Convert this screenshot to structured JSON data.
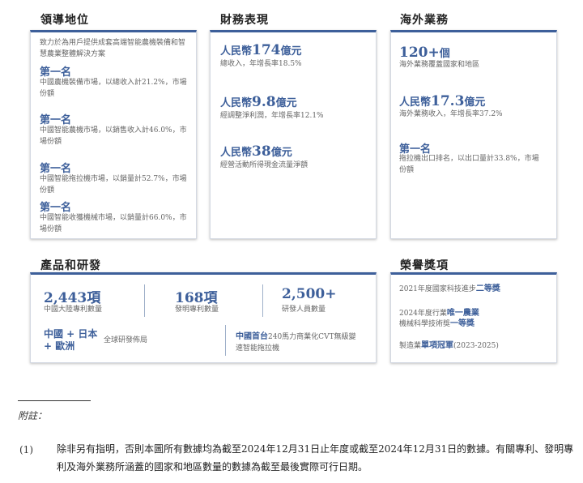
{
  "sections": {
    "leadership": "領導地位",
    "finance": "財務表現",
    "overseas": "海外業務",
    "products": "產品和研發",
    "honors": "榮譽獎項"
  },
  "leadership": {
    "intro": "致力於為用戶提供成套高端智能農機裝備和智慧農業整體解決方案",
    "items": [
      {
        "rank": "第一名",
        "desc": "中國農機裝備市場，以總收入計21.2%，市場份額"
      },
      {
        "rank": "第一名",
        "desc": "中國智能農機市場，以銷售收入計46.0%，市場份額"
      },
      {
        "rank": "第一名",
        "desc": "中國智能拖拉機市場，以銷量計52.7%，市場份額"
      },
      {
        "rank": "第一名",
        "desc": "中國智能收獲機械市場，以銷量計66.0%，市場份額"
      }
    ]
  },
  "finance": {
    "items": [
      {
        "prefix": "人民幣",
        "num": "174",
        "suffix": "億元",
        "desc": "總收入，年增長率18.5%"
      },
      {
        "prefix": "人民幣",
        "num": "9.8",
        "suffix": "億元",
        "desc": "經調整淨利潤，年增長率12.1%"
      },
      {
        "prefix": "人民幣",
        "num": "38",
        "suffix": "億元",
        "desc": "經營活動所得現金流量淨額"
      }
    ]
  },
  "overseas": {
    "items": [
      {
        "prefix": "",
        "num": "120+",
        "suffix": "個",
        "desc": "海外業務覆蓋國家和地區"
      },
      {
        "prefix": "人民幣",
        "num": "17.3",
        "suffix": "億元",
        "desc": "海外業務收入，年增長率37.2%"
      },
      {
        "prefix": "",
        "num": "",
        "suffix": "第一名",
        "desc": "拖拉機出口排名，以出口量計33.8%，市場份額"
      }
    ]
  },
  "products": {
    "stats": [
      {
        "value": "2,443項",
        "desc": "中國大陸專利數量"
      },
      {
        "value": "168項",
        "desc": "發明專利數量"
      },
      {
        "value": "2,500+",
        "desc": "研發人員數量"
      }
    ],
    "region_label": "中國 + 日本 + 歐洲",
    "region_desc": "全球研發佈局",
    "first_label": "中國首台",
    "first_desc": "240馬力商業化CVT無級變速智能拖拉機"
  },
  "honors": {
    "items": [
      {
        "pre": "2021年度國家科技進步",
        "bold": "二等獎",
        "post": ""
      },
      {
        "pre": "2024年度行業",
        "bold": "唯一農業",
        "post": ""
      },
      {
        "pre": "機械科學技術獎",
        "bold": "一等獎",
        "post": ""
      },
      {
        "pre": "製造業",
        "bold": "單項冠軍",
        "post": "(2023-2025)"
      }
    ]
  },
  "footnote": {
    "label": "附註：",
    "num": "(1)",
    "text": "除非另有指明，否則本圖所有數據均為截至2024年12月31日止年度或截至2024年12月31日的數據。有關專利、發明專利及海外業務所涵蓋的國家和地區數量的數據為截至最後實際可行日期。"
  }
}
